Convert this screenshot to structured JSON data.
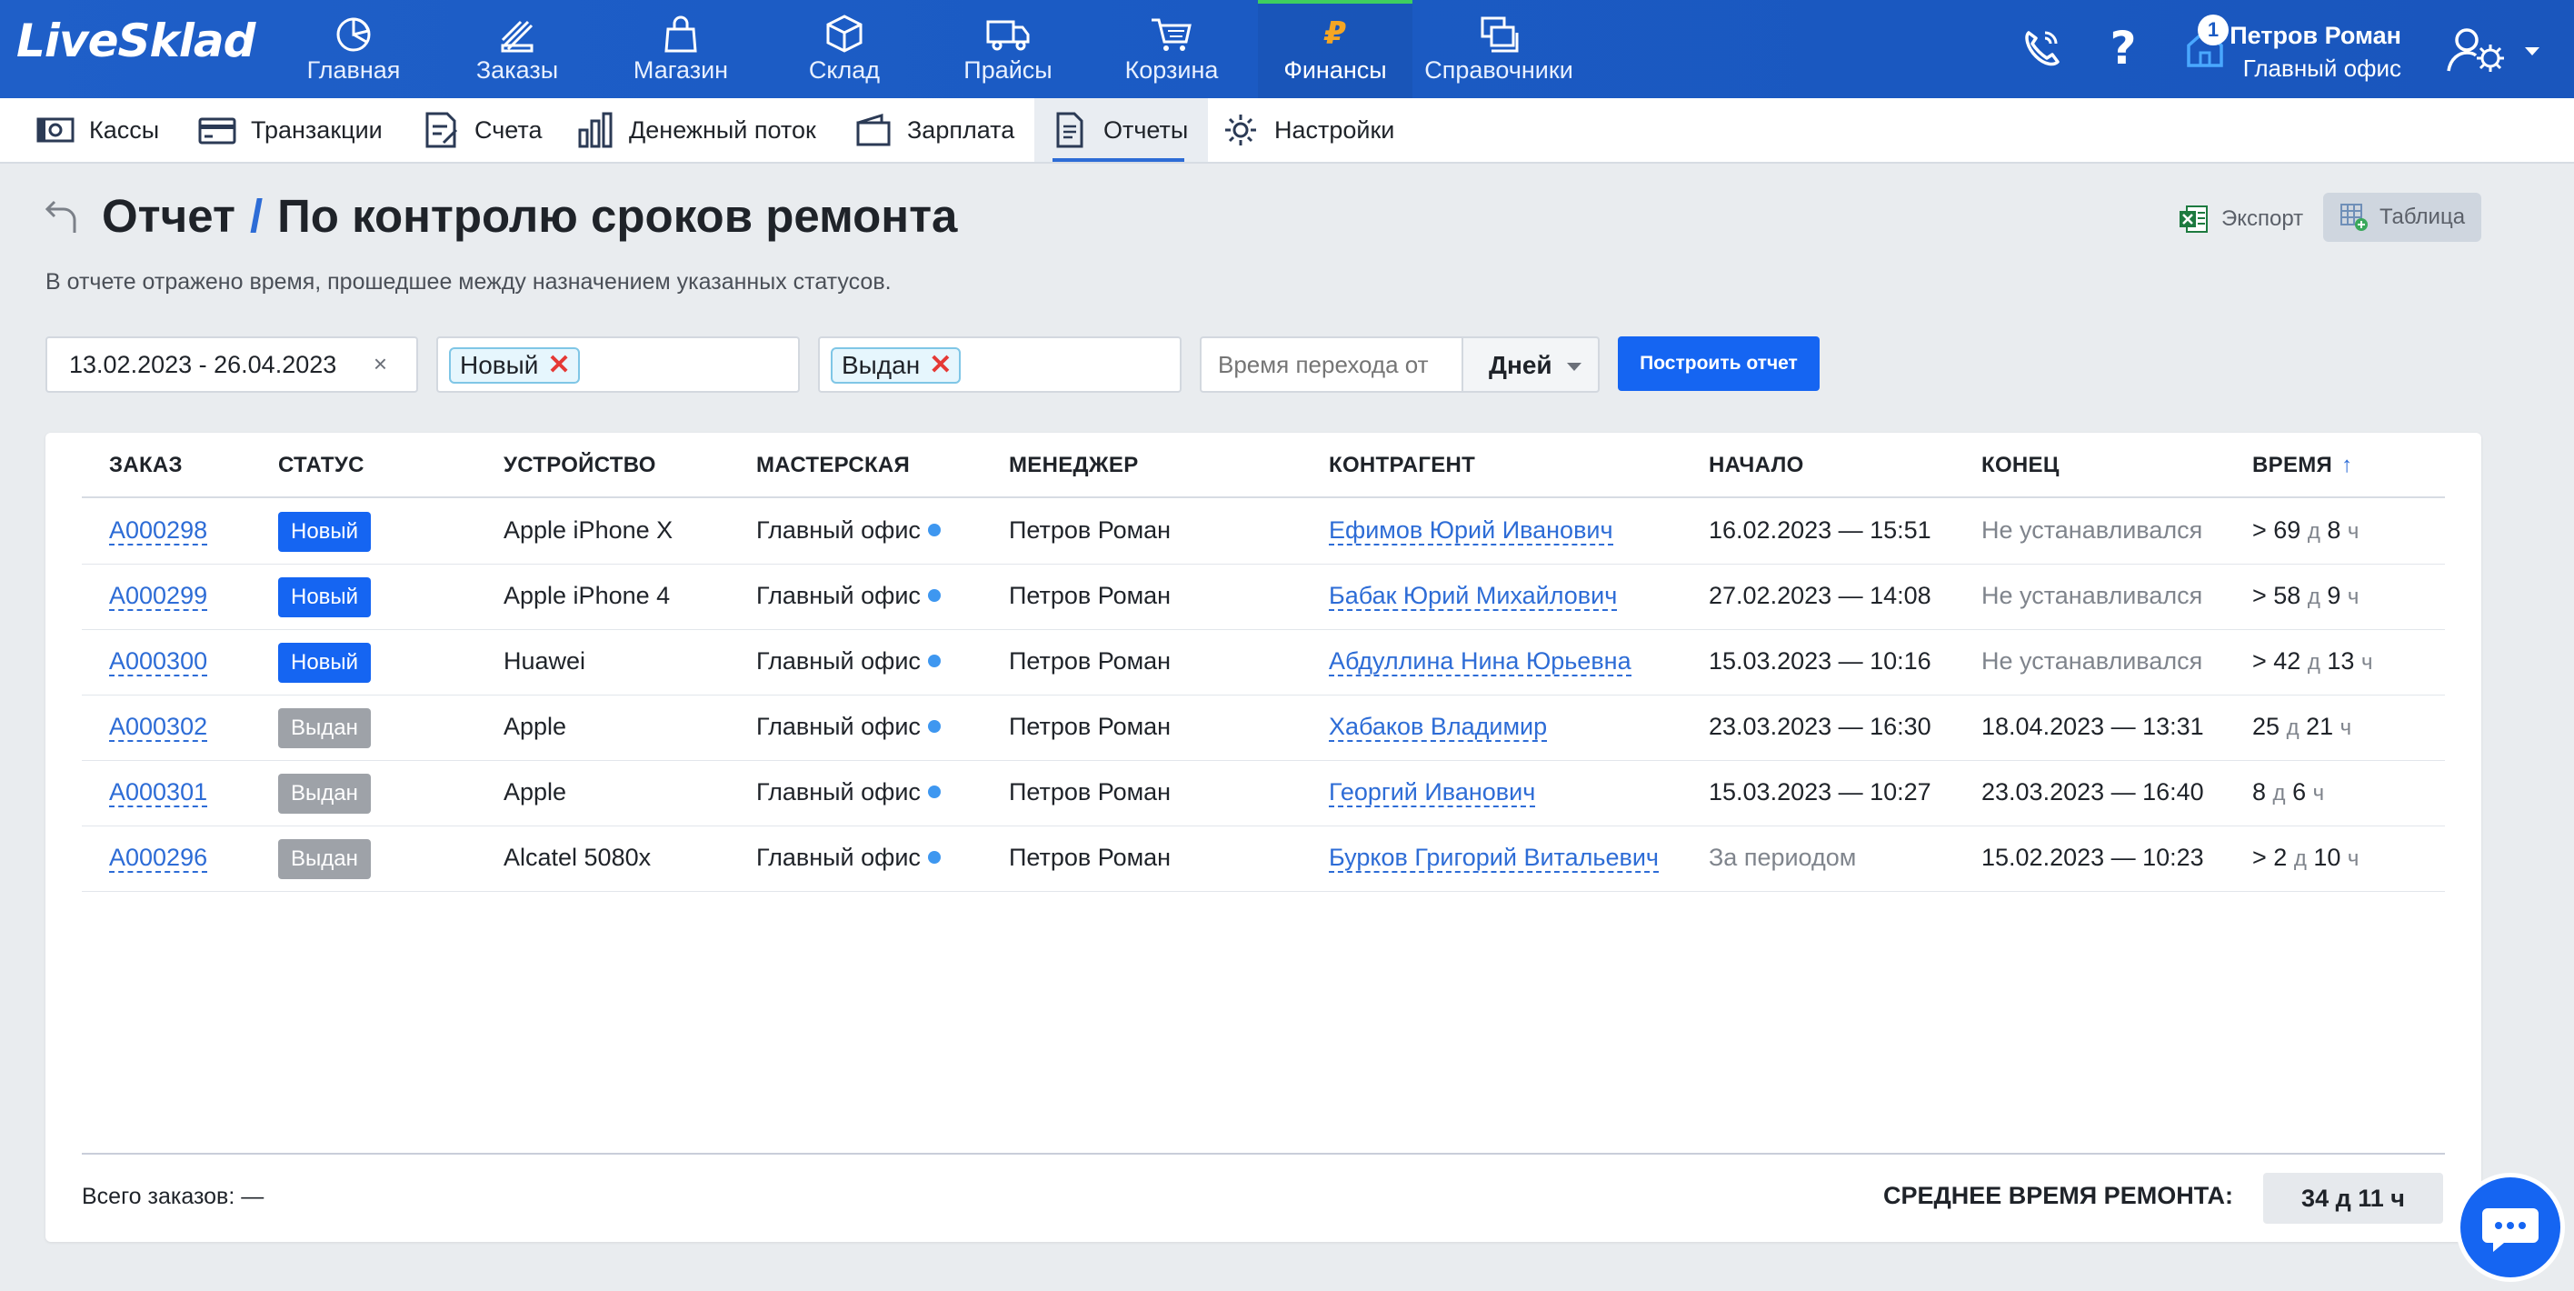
{
  "app": {
    "logo": "LiveSklad"
  },
  "nav": {
    "items": [
      {
        "label": "Главная",
        "icon": "pie-chart-icon"
      },
      {
        "label": "Заказы",
        "icon": "orders-icon"
      },
      {
        "label": "Магазин",
        "icon": "shopping-bag-icon"
      },
      {
        "label": "Склад",
        "icon": "box-icon"
      },
      {
        "label": "Прайсы",
        "icon": "truck-icon"
      },
      {
        "label": "Корзина",
        "icon": "cart-icon"
      },
      {
        "label": "Финансы",
        "icon": "ruble-icon"
      },
      {
        "label": "Справочники",
        "icon": "directories-icon"
      }
    ],
    "active": "Финансы"
  },
  "user": {
    "name": "Петров Роман",
    "office": "Главный офис",
    "notifications": "1"
  },
  "subnav": {
    "items": [
      {
        "label": "Кассы",
        "icon": "cash-icon"
      },
      {
        "label": "Транзакции",
        "icon": "card-icon"
      },
      {
        "label": "Счета",
        "icon": "invoice-icon"
      },
      {
        "label": "Денежный поток",
        "icon": "bar-chart-icon"
      },
      {
        "label": "Зарплата",
        "icon": "wallet-icon"
      },
      {
        "label": "Отчеты",
        "icon": "report-icon"
      },
      {
        "label": "Настройки",
        "icon": "settings-icon"
      }
    ],
    "active": "Отчеты"
  },
  "page": {
    "title_prefix": "Отчет",
    "title_sep": "/",
    "title": "По контролю сроков ремонта",
    "description": "В отчете отражено время, прошедшее между назначением указанных статусов.",
    "export_label": "Экспорт",
    "table_label": "Таблица"
  },
  "filters": {
    "date_range": "13.02.2023 - 26.04.2023",
    "clear": "×",
    "status_from": "Новый",
    "status_to": "Выдан",
    "chip_remove": "✕",
    "time_placeholder": "Время перехода от",
    "unit": "Дней",
    "build_label": "Построить отчет"
  },
  "table": {
    "headers": [
      "ЗАКАЗ",
      "СТАТУС",
      "УСТРОЙСТВО",
      "МАСТЕРСКАЯ",
      "МЕНЕДЖЕР",
      "КОНТРАГЕНТ",
      "НАЧАЛО",
      "КОНЕЦ",
      "ВРЕМЯ"
    ],
    "sort_arrow": "↑",
    "rows": [
      {
        "order": "A000298",
        "status": "Новый",
        "status_kind": "new",
        "device": "Apple iPhone X",
        "workshop": "Главный офис",
        "manager": "Петров Роман",
        "contractor": "Ефимов Юрий Иванович",
        "start": "16.02.2023 — 15:51",
        "end": "Не устанавливался",
        "time_prefix": "> ",
        "days": "69",
        "day_unit": "д",
        "hours": "8",
        "hour_unit": "ч"
      },
      {
        "order": "A000299",
        "status": "Новый",
        "status_kind": "new",
        "device": "Apple iPhone 4",
        "workshop": "Главный офис",
        "manager": "Петров Роман",
        "contractor": "Бабак Юрий Михайлович",
        "start": "27.02.2023 — 14:08",
        "end": "Не устанавливался",
        "time_prefix": "> ",
        "days": "58",
        "day_unit": "д",
        "hours": "9",
        "hour_unit": "ч"
      },
      {
        "order": "A000300",
        "status": "Новый",
        "status_kind": "new",
        "device": "Huawei",
        "workshop": "Главный офис",
        "manager": "Петров Роман",
        "contractor": "Абдуллина Нина Юрьевна",
        "start": "15.03.2023 — 10:16",
        "end": "Не устанавливался",
        "time_prefix": "> ",
        "days": "42",
        "day_unit": "д",
        "hours": "13",
        "hour_unit": "ч"
      },
      {
        "order": "A000302",
        "status": "Выдан",
        "status_kind": "issued",
        "device": "Apple",
        "workshop": "Главный офис",
        "manager": "Петров Роман",
        "contractor": "Хабаков Владимир",
        "start": "23.03.2023 — 16:30",
        "end": "18.04.2023 — 13:31",
        "time_prefix": "",
        "days": "25",
        "day_unit": "д",
        "hours": "21",
        "hour_unit": "ч"
      },
      {
        "order": "A000301",
        "status": "Выдан",
        "status_kind": "issued",
        "device": "Apple",
        "workshop": "Главный офис",
        "manager": "Петров Роман",
        "contractor": "Георгий Иванович",
        "start": "15.03.2023 — 10:27",
        "end": "23.03.2023 — 16:40",
        "time_prefix": "",
        "days": "8",
        "day_unit": "д",
        "hours": "6",
        "hour_unit": "ч"
      },
      {
        "order": "A000296",
        "status": "Выдан",
        "status_kind": "issued",
        "device": "Alcatel 5080x",
        "workshop": "Главный офис",
        "manager": "Петров Роман",
        "contractor": "Бурков Григорий Витальевич",
        "start": "За периодом",
        "end": "15.02.2023 — 10:23",
        "time_prefix": "> ",
        "days": "2",
        "day_unit": "д",
        "hours": "10",
        "hour_unit": "ч"
      }
    ]
  },
  "footer": {
    "total_label": "Всего заказов: —",
    "avg_label": "СРЕДНЕЕ ВРЕМЯ РЕМОНТА:",
    "avg_value": "34 д 11 ч"
  },
  "colors": {
    "topbar": "#1b5bc4",
    "accent": "#1565f2",
    "link": "#2d6cd6",
    "status_new": "#1565f2",
    "status_issued": "#9ea2a8",
    "active_indicator": "#3ecf5f"
  }
}
